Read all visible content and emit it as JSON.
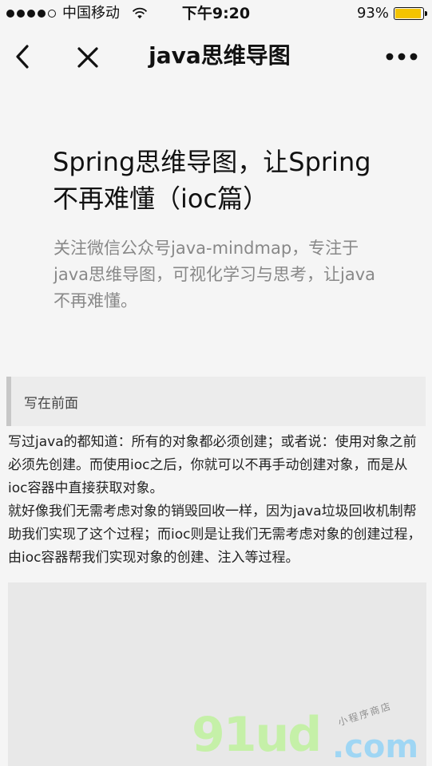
{
  "status_bar": {
    "carrier": "中国移动",
    "time": "下午9:20",
    "battery_level": "93%"
  },
  "nav": {
    "title": "java思维导图"
  },
  "article": {
    "title": "Spring思维导图，让Spring不再难懂（ioc篇）",
    "description": "关注微信公众号java-mindmap，专注于java思维导图，可视化学习与思考，让java不再难懂。",
    "quote": "写在前面",
    "paragraph_1": "写过java的都知道：所有的对象都必须创建；或者说：使用对象之前必须先创建。而使用ioc之后，你就可以不再手动创建对象，而是从ioc容器中直接获取对象。",
    "paragraph_2": "就好像我们无需考虑对象的销毁回收一样，因为java垃圾回收机制帮助我们实现了这个过程；而ioc则是让我们无需考虑对象的创建过程，由ioc容器帮我们实现对象的创建、注入等过程。"
  },
  "watermark": {
    "logo": "91ud",
    "domain": ".com",
    "tagline": "小程序商店"
  },
  "colors": {
    "battery": "#f4c400",
    "watermark_logo": "#c5f0a8",
    "watermark_domain": "#9fd6f4"
  },
  "icons": {
    "signal": "signal-dots-icon",
    "wifi": "wifi-icon",
    "battery": "battery-icon",
    "back": "back-arrow-icon",
    "close": "close-icon",
    "more": "more-options-icon"
  }
}
